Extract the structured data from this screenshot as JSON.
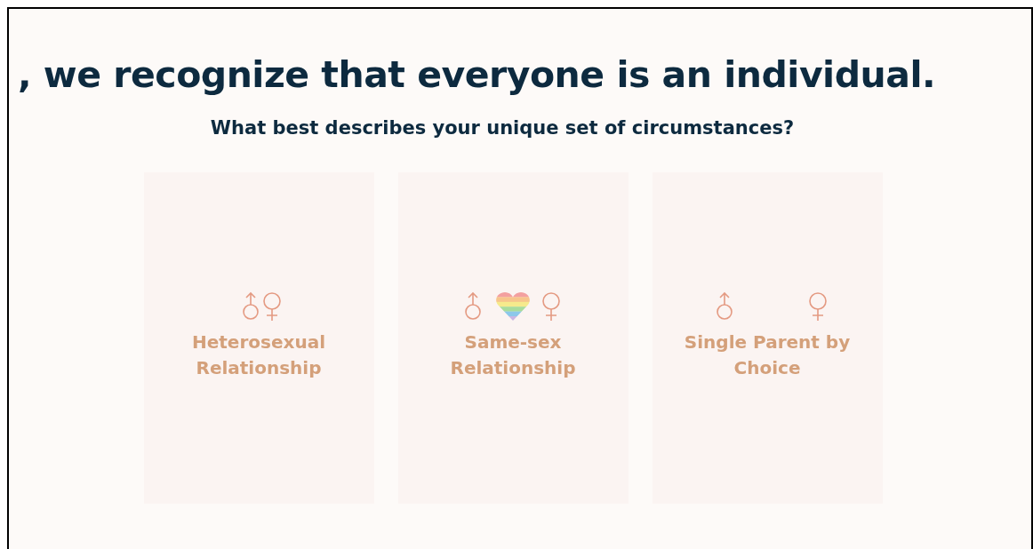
{
  "heading": ", we recognize that everyone is an individual.",
  "question": "What best describes your unique set of circumstances?",
  "options": [
    {
      "kind": "hetero",
      "label": "Heterosexual Relationship"
    },
    {
      "kind": "samesex",
      "label": "Same-sex Relationship"
    },
    {
      "kind": "single",
      "label": "Single Parent by Choice"
    }
  ]
}
